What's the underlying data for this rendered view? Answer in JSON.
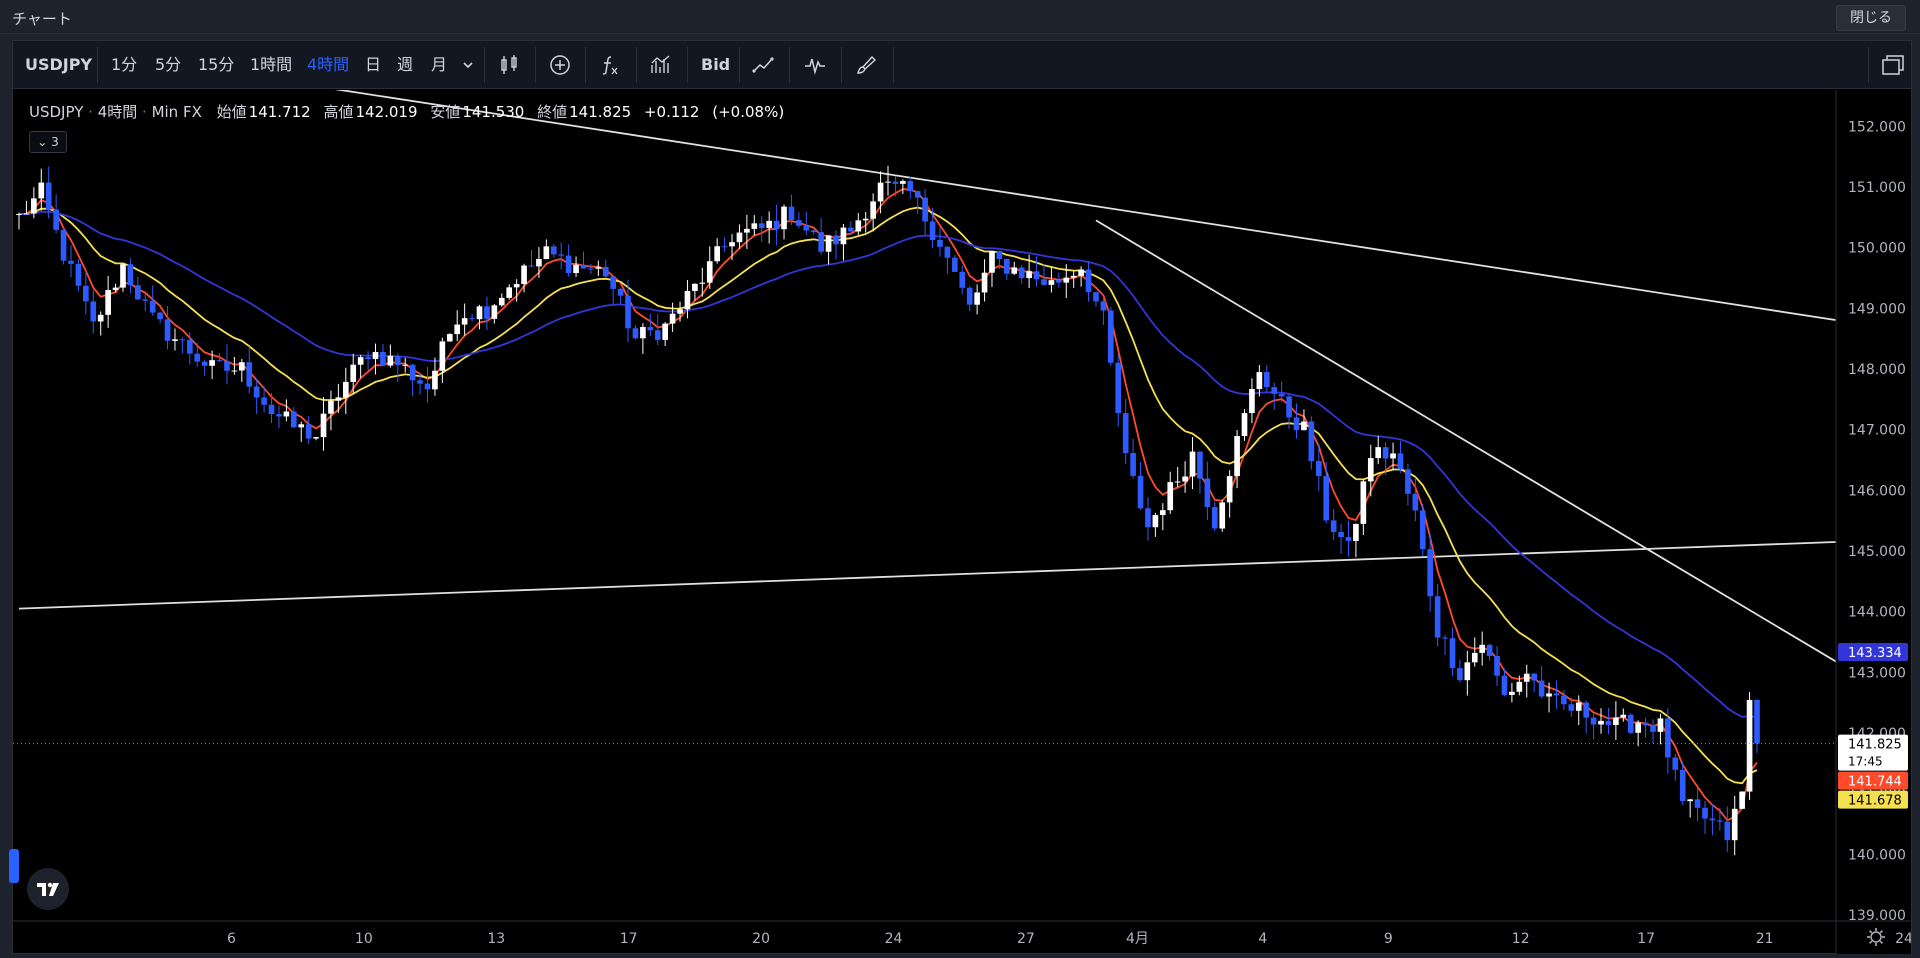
{
  "window": {
    "title": "チャート",
    "close_label": "閉じる"
  },
  "toolbar": {
    "symbol": "USDJPY",
    "intervals": [
      "1分",
      "5分",
      "15分",
      "1時間",
      "4時間",
      "日",
      "週",
      "月"
    ],
    "active_interval": "4時間",
    "bid_label": "Bid",
    "icons": [
      "candles-icon",
      "add-circle-icon",
      "function-icon",
      "compare-icon",
      "line-tool-icon",
      "pulse-icon",
      "brush-icon",
      "layout-icon"
    ]
  },
  "legend": {
    "symbol": "USDJPY",
    "interval": "4時間",
    "source": "Min FX",
    "open_label": "始値",
    "open": "141.712",
    "high_label": "高値",
    "high": "142.019",
    "low_label": "安値",
    "low": "141.530",
    "close_label": "終値",
    "close": "141.825",
    "change": "+0.112",
    "change_pct": "(+0.08%)",
    "indicator_toggle": "3"
  },
  "colors": {
    "up_candle": "#ffffff",
    "down_candle": "#2d5bff",
    "background": "#000000",
    "ma_fast": "#ff4b2b",
    "ma_mid": "#f5e050",
    "ma_slow": "#3236d8",
    "trendline": "#e0e0e0"
  },
  "chart_data": {
    "type": "candlestick",
    "x_ticks": [
      "6",
      "10",
      "13",
      "17",
      "20",
      "24",
      "27",
      "4月",
      "4",
      "9",
      "12",
      "17",
      "21",
      "24"
    ],
    "y_ticks": [
      "152.000",
      "151.000",
      "150.000",
      "149.000",
      "148.000",
      "147.000",
      "146.000",
      "145.000",
      "144.000",
      "143.000",
      "142.000",
      "141.000",
      "140.000",
      "139.000"
    ],
    "ylim": [
      138.9,
      152.6
    ],
    "price_labels": [
      {
        "value": 143.334,
        "text": "143.334",
        "color": "#3236d8",
        "series": "ma_slow"
      },
      {
        "value": 141.825,
        "text": "141.825",
        "sub": "17:45",
        "color": "#ffffff",
        "series": "last"
      },
      {
        "value": 141.744,
        "text": "141.744",
        "color": "#ff4b2b",
        "series": "ma_fast"
      },
      {
        "value": 141.678,
        "text": "141.678",
        "color": "#f5e050",
        "series": "ma_mid"
      }
    ],
    "last_price": 141.825,
    "n_bars": 235,
    "trendlines": [
      {
        "from": [
          38,
          152.7
        ],
        "to": [
          245,
          148.8
        ]
      },
      {
        "from": [
          145,
          150.45
        ],
        "to": [
          245,
          143.15
        ]
      },
      {
        "from": [
          0,
          144.05
        ],
        "to": [
          245,
          145.15
        ]
      }
    ],
    "anchors": [
      [
        0,
        150.5
      ],
      [
        3,
        150.9
      ],
      [
        6,
        149.9
      ],
      [
        10,
        148.7
      ],
      [
        14,
        149.7
      ],
      [
        18,
        148.8
      ],
      [
        22,
        148.4
      ],
      [
        26,
        148.0
      ],
      [
        30,
        148.0
      ],
      [
        34,
        147.3
      ],
      [
        37,
        147.05
      ],
      [
        40,
        146.9
      ],
      [
        43,
        147.6
      ],
      [
        47,
        148.3
      ],
      [
        51,
        148.1
      ],
      [
        55,
        147.7
      ],
      [
        59,
        148.9
      ],
      [
        63,
        149.0
      ],
      [
        67,
        149.5
      ],
      [
        71,
        149.9
      ],
      [
        75,
        149.7
      ],
      [
        79,
        149.6
      ],
      [
        83,
        148.5
      ],
      [
        87,
        148.7
      ],
      [
        92,
        149.5
      ],
      [
        96,
        150.2
      ],
      [
        100,
        150.3
      ],
      [
        104,
        150.6
      ],
      [
        108,
        150.0
      ],
      [
        112,
        150.3
      ],
      [
        116,
        151.0
      ],
      [
        120,
        150.9
      ],
      [
        124,
        150.1
      ],
      [
        128,
        149.0
      ],
      [
        131,
        149.8
      ],
      [
        135,
        149.6
      ],
      [
        139,
        149.4
      ],
      [
        143,
        149.7
      ],
      [
        146,
        148.8
      ],
      [
        149,
        146.5
      ],
      [
        152,
        145.4
      ],
      [
        155,
        146.0
      ],
      [
        158,
        146.6
      ],
      [
        161,
        145.5
      ],
      [
        164,
        146.8
      ],
      [
        167,
        148.0
      ],
      [
        170,
        147.4
      ],
      [
        173,
        147.0
      ],
      [
        176,
        145.6
      ],
      [
        179,
        145.0
      ],
      [
        182,
        146.6
      ],
      [
        185,
        146.6
      ],
      [
        188,
        145.6
      ],
      [
        191,
        143.7
      ],
      [
        194,
        143.0
      ],
      [
        197,
        143.5
      ],
      [
        200,
        142.6
      ],
      [
        203,
        143.0
      ],
      [
        206,
        142.5
      ],
      [
        209,
        142.4
      ],
      [
        212,
        142.3
      ],
      [
        215,
        142.1
      ],
      [
        218,
        142.2
      ],
      [
        221,
        142.1
      ],
      [
        224,
        140.8
      ],
      [
        227,
        140.6
      ],
      [
        230,
        140.3
      ],
      [
        232,
        141.0
      ],
      [
        233,
        142.5
      ],
      [
        234,
        141.825
      ]
    ]
  }
}
